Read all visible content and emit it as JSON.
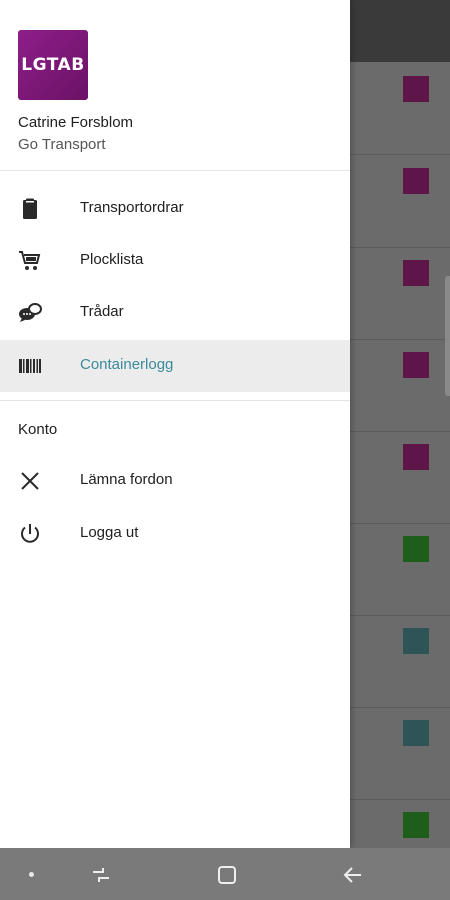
{
  "drawer": {
    "logo_text": "LGTAB",
    "user_name": "Catrine Forsblom",
    "company": "Go Transport",
    "items": [
      {
        "label": "Transportordrar",
        "icon": "clipboard-icon"
      },
      {
        "label": "Plocklista",
        "icon": "cart-icon"
      },
      {
        "label": "Trådar",
        "icon": "chat-bubbles-icon"
      },
      {
        "label": "Containerlogg",
        "icon": "barcode-icon",
        "active": true
      }
    ],
    "account_section": {
      "title": "Konto",
      "items": [
        {
          "label": "Lämna fordon",
          "icon": "close-icon"
        },
        {
          "label": "Logga ut",
          "icon": "power-icon"
        }
      ]
    }
  },
  "background_rows": {
    "swatch_colors": [
      "#5e1649",
      "#5e1649",
      "#5e1649",
      "#5e1649",
      "#5e1649",
      "#1f5e1a",
      "#2f5458",
      "#2f5458",
      "#1f5e1a"
    ]
  },
  "colors": {
    "accent": "#3b8b9a",
    "logo": "#8e1e8a",
    "active_bg": "#ececec"
  },
  "navbar": {
    "buttons": [
      "dot-icon",
      "recent-apps-icon",
      "home-icon",
      "back-icon"
    ]
  }
}
